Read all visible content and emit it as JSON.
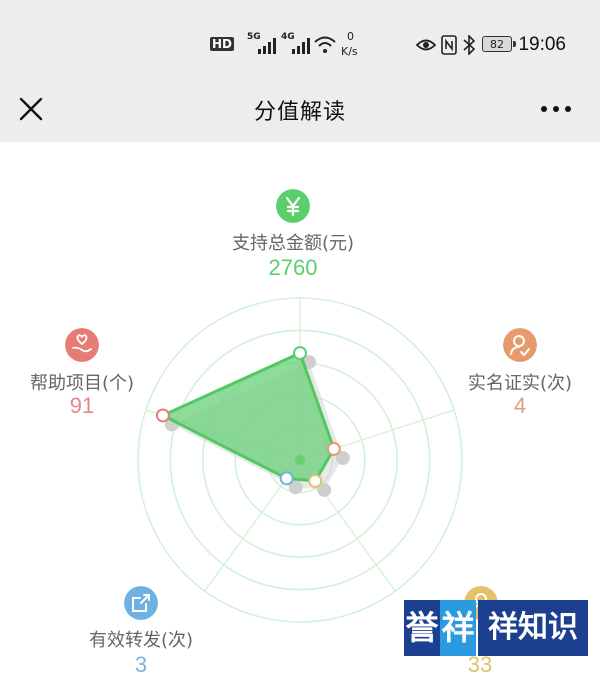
{
  "status_bar": {
    "hd": "HD",
    "sim1": "5G",
    "sim2": "4G",
    "speed_value": "0",
    "speed_unit": "K/s",
    "battery": "82",
    "time": "19:06"
  },
  "nav": {
    "title": "分值解读"
  },
  "radar": {
    "colors": {
      "fill": "#6fd17f",
      "stroke": "#52c95f",
      "grid": "#d4f2d8"
    },
    "dimensions": [
      {
        "key": "support",
        "label": "支持总金额(元)",
        "value": "2760",
        "icon": "yen-icon",
        "color": "#5ccf6d",
        "score": 0.66
      },
      {
        "key": "realname",
        "label": "实名证实(次)",
        "value": "4",
        "icon": "person-check-icon",
        "color": "#e69a6e",
        "score": 0.22
      },
      {
        "key": "fifth",
        "label": "",
        "value": "33",
        "icon": "person-icon",
        "color": "#e4c06b",
        "score": 0.16
      },
      {
        "key": "share",
        "label": "有效转发(次)",
        "value": "3",
        "icon": "share-icon",
        "color": "#6fb1e2",
        "score": 0.14
      },
      {
        "key": "help",
        "label": "帮助项目(个)",
        "value": "91",
        "icon": "heart-hand-icon",
        "color": "#e67c75",
        "score": 0.89
      }
    ]
  },
  "watermark": {
    "part1": "誉",
    "part2": "祥",
    "part3": "祥知识"
  }
}
